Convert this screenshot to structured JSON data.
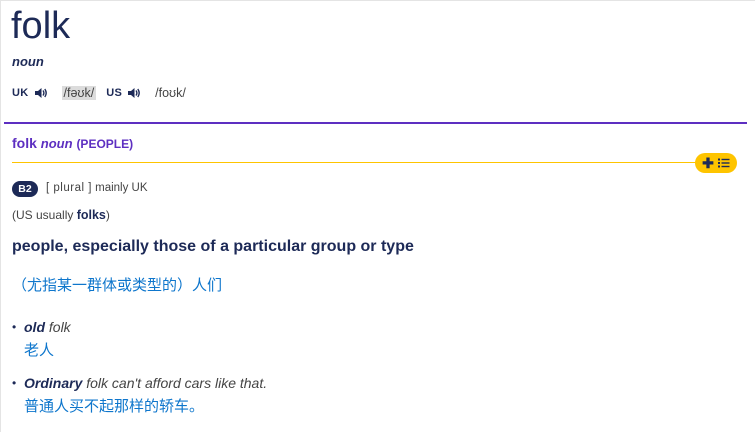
{
  "entry": {
    "headword": "folk",
    "part_of_speech": "noun"
  },
  "pronunciations": [
    {
      "region": "UK",
      "ipa": "/fəʊk/",
      "icon": "speaker-icon"
    },
    {
      "region": "US",
      "ipa": "/foʊk/",
      "icon": "speaker-icon"
    }
  ],
  "sense": {
    "word": "folk",
    "pos": "noun",
    "guideword": "(PEOPLE)",
    "add_button_icons": [
      "plus-icon",
      "list-icon"
    ],
    "level": "B2",
    "grammar_prefix": "[ plural ]",
    "grammar_suffix": "mainly UK",
    "variant_open": "(",
    "variant_label": "US usually",
    "variant_word": "folks",
    "variant_close": ")",
    "definition": "people, especially those of a particular group or type",
    "translation": "（尤指某一群体或类型的）人们",
    "examples": [
      {
        "bullet": "•",
        "highlight": "old",
        "rest": " folk",
        "translation": "老人"
      },
      {
        "bullet": "•",
        "highlight": "Ordinary",
        "rest": " folk can't afford cars like that.",
        "translation": "普通人买不起那样的轿车。"
      }
    ]
  },
  "colors": {
    "navy": "#1d2a57",
    "purple": "#5d2fc1",
    "yellow": "#fec400",
    "translation_blue": "#0e76cc"
  }
}
